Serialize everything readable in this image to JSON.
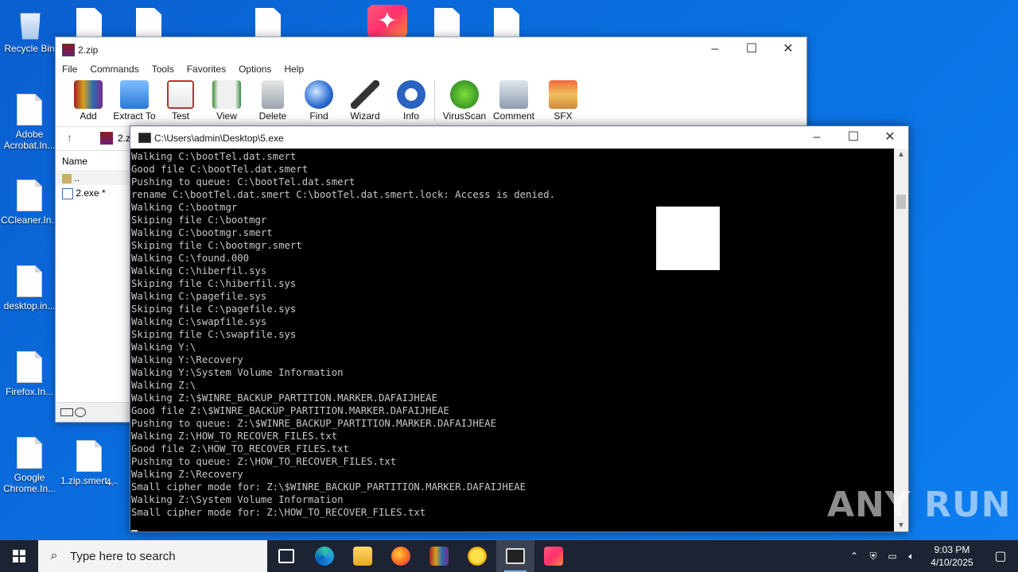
{
  "desktop": {
    "icons": [
      {
        "label": "Recycle Bin"
      },
      {
        "label": "Adobe Acrobat.In..."
      },
      {
        "label": "CCleaner.In..."
      },
      {
        "label": "desktop.in..."
      },
      {
        "label": "Firefox.In..."
      },
      {
        "label": "Google Chrome.In..."
      },
      {
        "label": "1.zip.smert...."
      },
      {
        "label": "4."
      }
    ]
  },
  "winrar": {
    "title": "2.zip",
    "menu": [
      "File",
      "Commands",
      "Tools",
      "Favorites",
      "Options",
      "Help"
    ],
    "toolbar": [
      "Add",
      "Extract To",
      "Test",
      "View",
      "Delete",
      "Find",
      "Wizard",
      "Info",
      "VirusScan",
      "Comment",
      "SFX"
    ],
    "address": "2.z",
    "column_name": "Name",
    "files": [
      "..",
      "2.exe *"
    ]
  },
  "console": {
    "title": "C:\\Users\\admin\\Desktop\\5.exe",
    "lines": [
      "Walking C:\\bootTel.dat.smert",
      "Good file C:\\bootTel.dat.smert",
      "Pushing to queue: C:\\bootTel.dat.smert",
      "rename C:\\bootTel.dat.smert C:\\bootTel.dat.smert.lock: Access is denied.",
      "Walking C:\\bootmgr",
      "Skiping file C:\\bootmgr",
      "Walking C:\\bootmgr.smert",
      "Skiping file C:\\bootmgr.smert",
      "Walking C:\\found.000",
      "Walking C:\\hiberfil.sys",
      "Skiping file C:\\hiberfil.sys",
      "Walking C:\\pagefile.sys",
      "Skiping file C:\\pagefile.sys",
      "Walking C:\\swapfile.sys",
      "Skiping file C:\\swapfile.sys",
      "Walking Y:\\",
      "Walking Y:\\Recovery",
      "Walking Y:\\System Volume Information",
      "Walking Z:\\",
      "Walking Z:\\$WINRE_BACKUP_PARTITION.MARKER.DAFAIJHEAE",
      "Good file Z:\\$WINRE_BACKUP_PARTITION.MARKER.DAFAIJHEAE",
      "Pushing to queue: Z:\\$WINRE_BACKUP_PARTITION.MARKER.DAFAIJHEAE",
      "Walking Z:\\HOW_TO_RECOVER_FILES.txt",
      "Good file Z:\\HOW_TO_RECOVER_FILES.txt",
      "Pushing to queue: Z:\\HOW_TO_RECOVER_FILES.txt",
      "Walking Z:\\Recovery",
      "Small cipher mode for: Z:\\$WINRE_BACKUP_PARTITION.MARKER.DAFAIJHEAE",
      "Walking Z:\\System Volume Information",
      "Small cipher mode for: Z:\\HOW_TO_RECOVER_FILES.txt"
    ]
  },
  "watermark": "ANY RUN",
  "taskbar": {
    "search_placeholder": "Type here to search",
    "time": "9:03 PM",
    "date": "4/10/2025"
  }
}
